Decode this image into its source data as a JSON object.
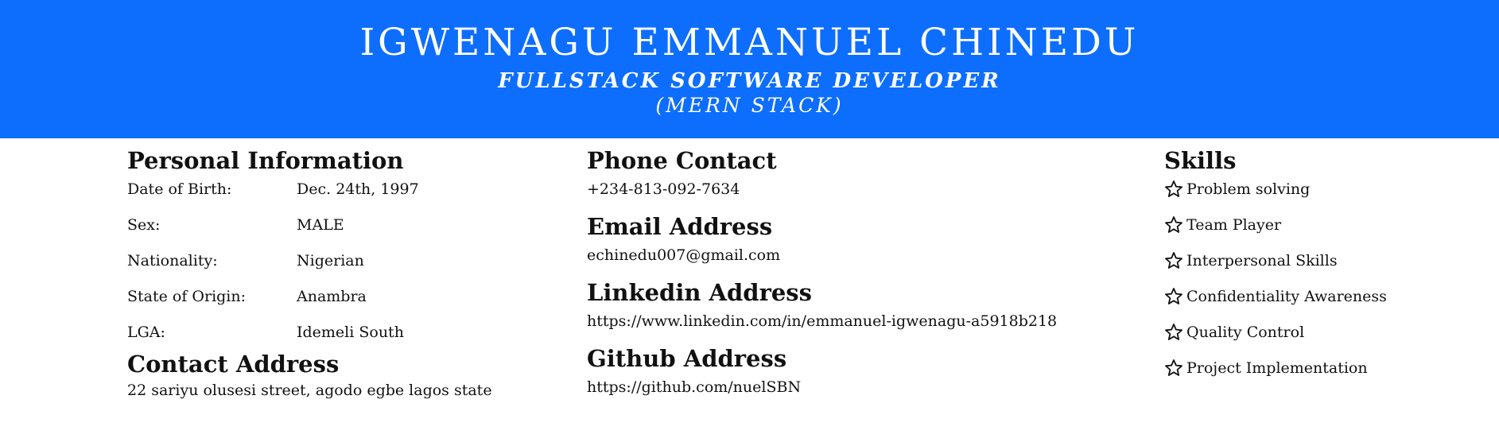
{
  "header": {
    "name": "IGWENAGU EMMANUEL CHINEDU",
    "role": "FULLSTACK SOFTWARE DEVELOPER",
    "stack": "(MERN STACK)",
    "accent_color": "#0d6efd"
  },
  "personal": {
    "heading": "Personal Information",
    "rows": [
      {
        "label": "Date of Birth:",
        "value": "Dec. 24th, 1997"
      },
      {
        "label": "Sex:",
        "value": "MALE"
      },
      {
        "label": "Nationality:",
        "value": "Nigerian"
      },
      {
        "label": "State of Origin:",
        "value": "Anambra"
      },
      {
        "label": "LGA:",
        "value": "Idemeli South"
      }
    ]
  },
  "contact_address": {
    "heading": "Contact Address",
    "value": "22 sariyu olusesi street, agodo egbe lagos state"
  },
  "phone": {
    "heading": "Phone Contact",
    "value": "+234-813-092-7634"
  },
  "email": {
    "heading": "Email Address",
    "value": "echinedu007@gmail.com"
  },
  "linkedin": {
    "heading": "Linkedin Address",
    "value": "https://www.linkedin.com/in/emmanuel-igwenagu-a5918b218"
  },
  "github": {
    "heading": "Github Address",
    "value": "https://github.com/nuelSBN"
  },
  "skills": {
    "heading": "Skills",
    "icon": "star-outline-icon",
    "items": [
      "Problem solving",
      "Team Player",
      "Interpersonal Skills",
      "Confidentiality Awareness",
      "Quality Control",
      "Project Implementation"
    ]
  }
}
